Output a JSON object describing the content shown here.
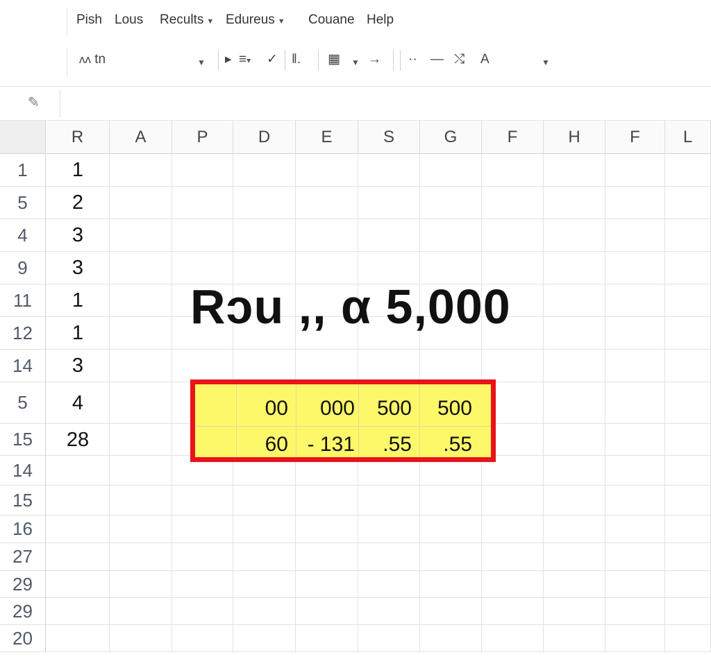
{
  "menu": {
    "items": [
      "Pish",
      "Lous",
      "Recults",
      "Edureus",
      "Couane",
      "Help"
    ]
  },
  "toolbar": {
    "font_name": "tn",
    "font_icon_glyph": "ʌʌ"
  },
  "formula_bar": {
    "value": ""
  },
  "columns": [
    "R",
    "A",
    "P",
    "D",
    "E",
    "S",
    "G",
    "F",
    "H",
    "F",
    "L"
  ],
  "rows": [
    {
      "num": "1",
      "r": "1"
    },
    {
      "num": "5",
      "r": "2"
    },
    {
      "num": "4",
      "r": "3"
    },
    {
      "num": "9",
      "r": "3"
    },
    {
      "num": "11",
      "r": "1"
    },
    {
      "num": "12",
      "r": "1"
    },
    {
      "num": "14",
      "r": "3"
    },
    {
      "num": "5",
      "r": "4"
    },
    {
      "num": "15",
      "r": "28"
    },
    {
      "num": "14",
      "r": ""
    },
    {
      "num": "15",
      "r": ""
    },
    {
      "num": "16",
      "r": ""
    },
    {
      "num": "27",
      "r": ""
    },
    {
      "num": "29",
      "r": ""
    },
    {
      "num": "29",
      "r": ""
    },
    {
      "num": "20",
      "r": ""
    }
  ],
  "overlay": {
    "title": "Rɔu ,, α  5,000"
  },
  "highlight": {
    "row1": [
      "00",
      "000",
      "500",
      "500"
    ],
    "row2": [
      "60",
      "- 131",
      ".55",
      ".55"
    ],
    "fill_color": "#fdf86a",
    "border_color": "#e8141a"
  }
}
